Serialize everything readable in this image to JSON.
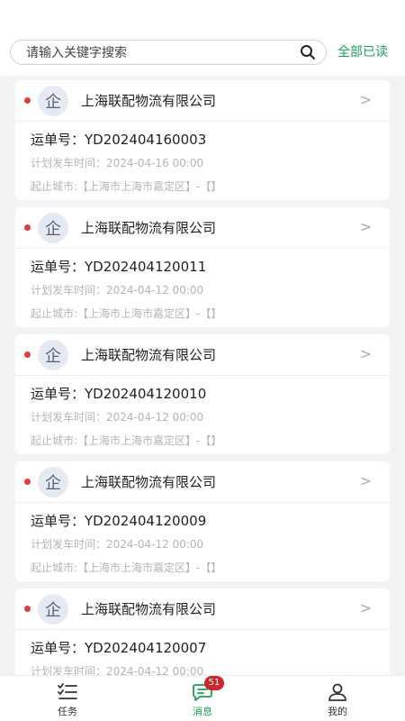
{
  "search": {
    "placeholder": "请输入关键字搜索"
  },
  "header": {
    "mark_all_read": "全部已读"
  },
  "messages": [
    {
      "company_icon": "企",
      "company": "上海联配物流有限公司",
      "waybill": "运单号：YD202404160003",
      "plan_time": "计划发车时间：2024-04-16 00:00",
      "route": "起止城市:【上海市上海市嘉定区】-【】",
      "unread": true
    },
    {
      "company_icon": "企",
      "company": "上海联配物流有限公司",
      "waybill": "运单号：YD202404120011",
      "plan_time": "计划发车时间：2024-04-12 00:00",
      "route": "起止城市:【上海市上海市嘉定区】-【】",
      "unread": true
    },
    {
      "company_icon": "企",
      "company": "上海联配物流有限公司",
      "waybill": "运单号：YD202404120010",
      "plan_time": "计划发车时间：2024-04-12 00:00",
      "route": "起止城市:【上海市上海市嘉定区】-【】",
      "unread": true
    },
    {
      "company_icon": "企",
      "company": "上海联配物流有限公司",
      "waybill": "运单号：YD202404120009",
      "plan_time": "计划发车时间：2024-04-12 00:00",
      "route": "起止城市:【上海市上海市嘉定区】-【】",
      "unread": true
    },
    {
      "company_icon": "企",
      "company": "上海联配物流有限公司",
      "waybill": "运单号：YD202404120007",
      "plan_time": "计划发车时间：2024-04-12 00:00",
      "route": "",
      "unread": true
    }
  ],
  "chevron": ">",
  "tabbar": {
    "tabs": [
      {
        "label": "任务",
        "icon": "task-list-icon"
      },
      {
        "label": "消息",
        "icon": "message-icon",
        "badge": "51"
      },
      {
        "label": "我的",
        "icon": "user-icon"
      }
    ]
  },
  "colors": {
    "accent": "#18a058",
    "badge": "#c9282d",
    "unread_dot": "#e23b3b"
  }
}
